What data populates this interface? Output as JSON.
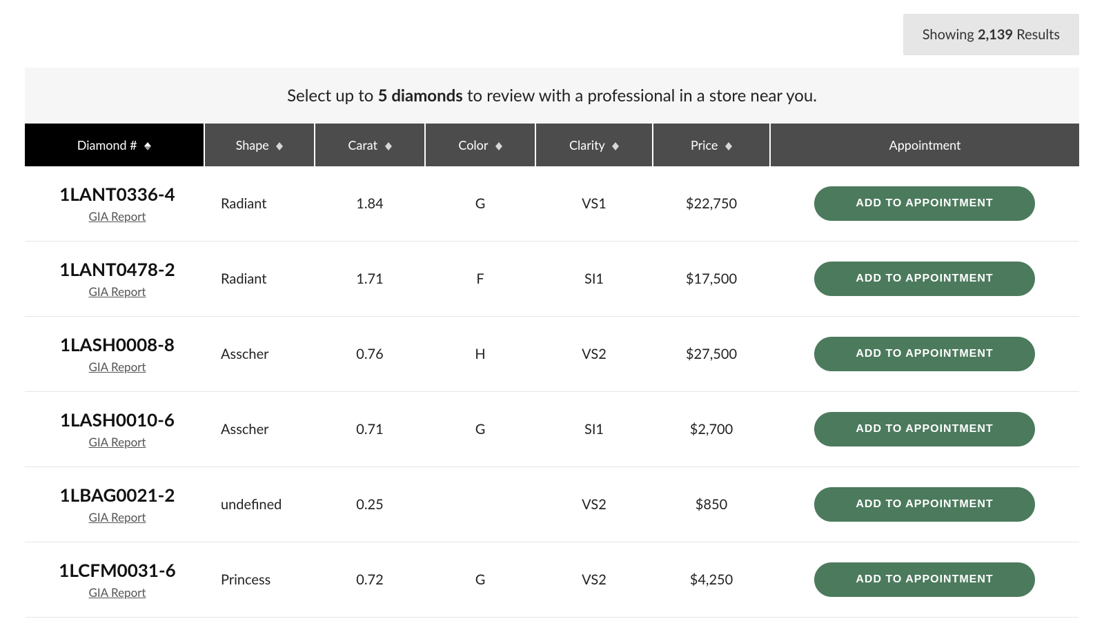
{
  "results": {
    "prefix": "Showing",
    "count": "2,139",
    "suffix": "Results"
  },
  "banner": {
    "before": "Select up to",
    "bold": "5 diamonds",
    "after": "to review with a professional in a store near you."
  },
  "columns": {
    "id": "Diamond #",
    "shape": "Shape",
    "carat": "Carat",
    "color": "Color",
    "clarity": "Clarity",
    "price": "Price",
    "appt": "Appointment"
  },
  "labels": {
    "gia": "GIA Report",
    "add": "ADD TO APPOINTMENT"
  },
  "rows": [
    {
      "id": "1LANT0336-4",
      "shape": "Radiant",
      "carat": "1.84",
      "color": "G",
      "clarity": "VS1",
      "price": "$22,750"
    },
    {
      "id": "1LANT0478-2",
      "shape": "Radiant",
      "carat": "1.71",
      "color": "F",
      "clarity": "SI1",
      "price": "$17,500"
    },
    {
      "id": "1LASH0008-8",
      "shape": "Asscher",
      "carat": "0.76",
      "color": "H",
      "clarity": "VS2",
      "price": "$27,500"
    },
    {
      "id": "1LASH0010-6",
      "shape": "Asscher",
      "carat": "0.71",
      "color": "G",
      "clarity": "SI1",
      "price": "$2,700"
    },
    {
      "id": "1LBAG0021-2",
      "shape": "undefined",
      "carat": "0.25",
      "color": "",
      "clarity": "VS2",
      "price": "$850"
    },
    {
      "id": "1LCFM0031-6",
      "shape": "Princess",
      "carat": "0.72",
      "color": "G",
      "clarity": "VS2",
      "price": "$4,250"
    }
  ]
}
